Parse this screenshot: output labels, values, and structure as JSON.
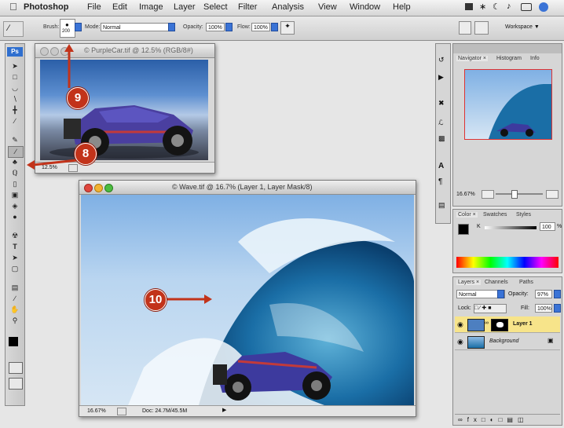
{
  "menubar": {
    "apple": "",
    "items": [
      "Photoshop",
      "File",
      "Edit",
      "Image",
      "Layer",
      "Select",
      "Filter",
      "Analysis",
      "View",
      "Window",
      "Help"
    ]
  },
  "options": {
    "brush_label": "Brush:",
    "brush_size": "200",
    "mode_label": "Mode:",
    "mode_value": "Normal",
    "opacity_label": "Opacity:",
    "opacity_value": "100%",
    "flow_label": "Flow:",
    "flow_value": "100%",
    "workspace_label": "Workspace ▼"
  },
  "tools": {
    "logo": "Ps",
    "items": [
      "move",
      "marquee",
      "lasso",
      "quick-select",
      "crop",
      "slice",
      "heal",
      "brush",
      "stamp",
      "history-brush",
      "eraser",
      "gradient",
      "blur",
      "dodge",
      "pen",
      "type",
      "path-select",
      "shape",
      "notes",
      "eyedropper",
      "hand",
      "zoom"
    ]
  },
  "window_car": {
    "title": "© PurpleCar.tif @ 12.5% (RGB/8#)",
    "zoom": "12.5%"
  },
  "window_wave": {
    "title": "© Wave.tif @ 16.7% (Layer 1, Layer Mask/8)",
    "zoom": "16.67%",
    "doc": "Doc: 24.7M/45.5M"
  },
  "navigator": {
    "tabs": [
      "Navigator ×",
      "Histogram",
      "Info"
    ],
    "zoom": "16.67%"
  },
  "color": {
    "tabs": [
      "Color ×",
      "Swatches",
      "Styles"
    ],
    "k_label": "K",
    "k_value": "100",
    "k_pct": "%"
  },
  "layers": {
    "tabs": [
      "Layers ×",
      "Channels",
      "Paths"
    ],
    "blend": "Normal",
    "opacity_label": "Opacity:",
    "opacity_value": "97%",
    "lock_label": "Lock:",
    "fill_label": "Fill:",
    "fill_value": "100%",
    "rows": [
      {
        "name": "Layer 1"
      },
      {
        "name": "Background"
      }
    ]
  },
  "callouts": {
    "c8": "8",
    "c9": "9",
    "c10": "10"
  },
  "colors": {
    "callout": "#c2331a",
    "highlight_layer": "#f7e48a",
    "accent_blue": "#3a73d6"
  }
}
